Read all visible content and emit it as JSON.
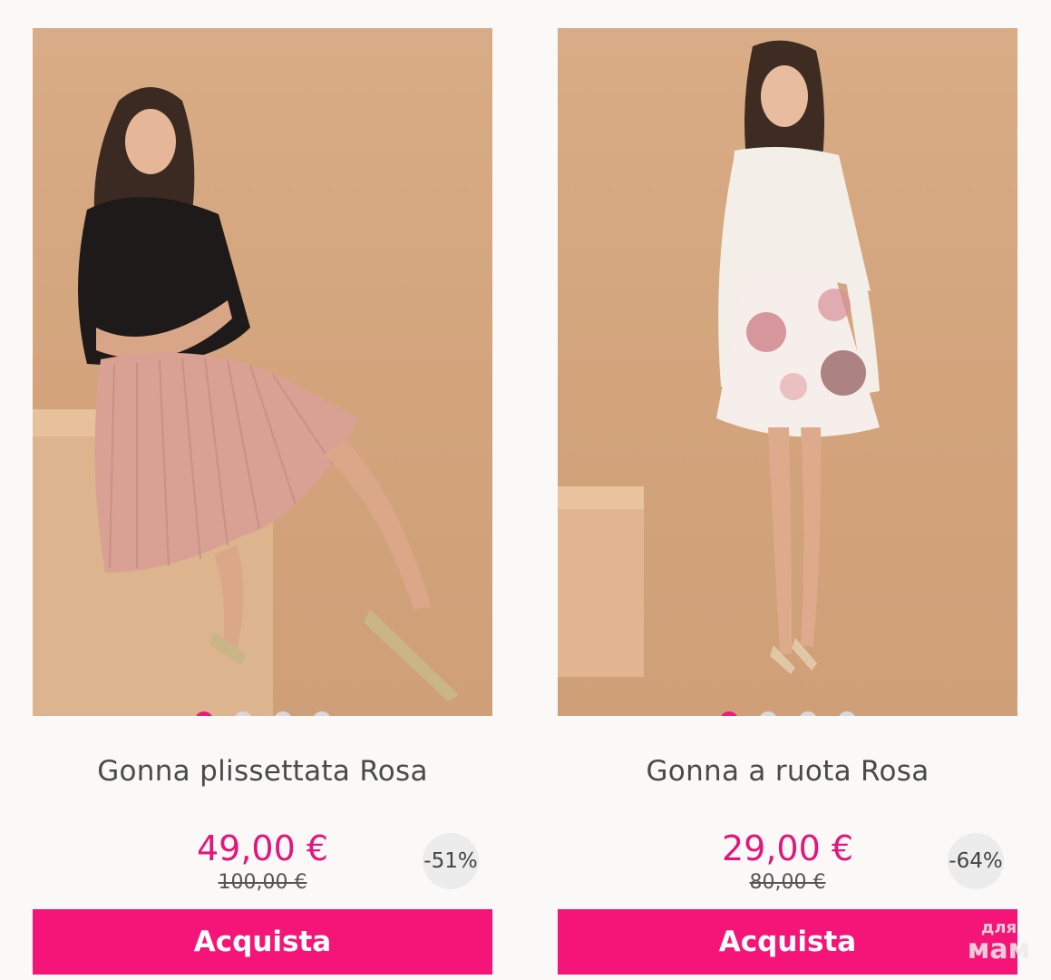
{
  "products": [
    {
      "name": "Gonna plissettata Rosa",
      "price": "49,00 €",
      "old_price": "100,00 €",
      "discount": "-51%",
      "buy_label": "Acquista",
      "image_count": 4,
      "active_image": 1
    },
    {
      "name": "Gonna a ruota Rosa",
      "price": "29,00 €",
      "old_price": "80,00 €",
      "discount": "-64%",
      "buy_label": "Acquista",
      "image_count": 4,
      "active_image": 1
    }
  ],
  "watermark": {
    "line1": "для",
    "line2": "мам"
  },
  "colors": {
    "accent": "#f51477",
    "price": "#e3167a",
    "dot_active": "#ec1c79",
    "dot_inactive": "#d9d9db",
    "badge_bg": "#ececec",
    "photo_bg": "#d3a47c"
  }
}
